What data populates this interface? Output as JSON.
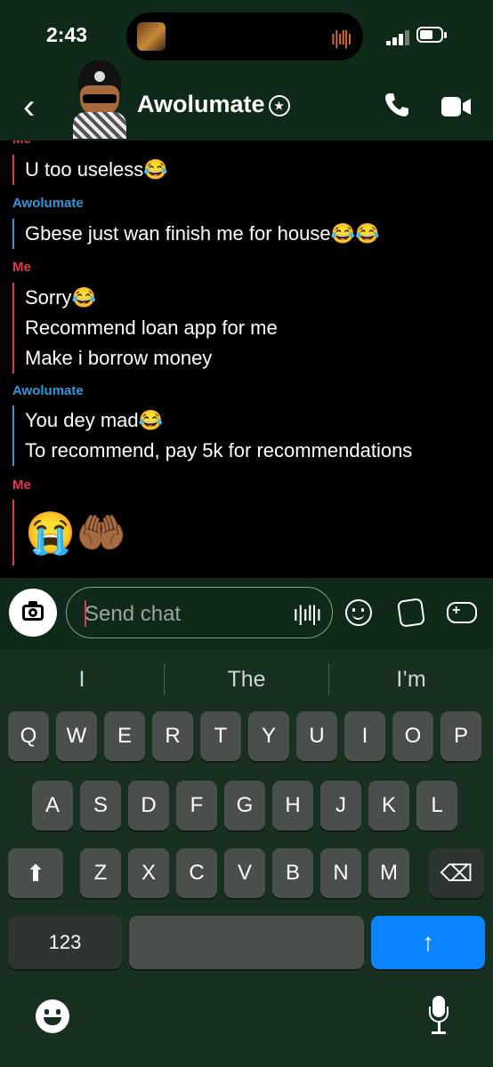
{
  "status": {
    "time": "2:43"
  },
  "header": {
    "contact_name": "Awolumate",
    "badge": "★"
  },
  "messages": [
    {
      "sender_label": "Me",
      "lines": [
        "U too useless😂"
      ]
    },
    {
      "sender_label": "Awolumate",
      "lines": [
        "Gbese just wan finish me for house😂😂"
      ]
    },
    {
      "sender_label": "Me",
      "lines": [
        "Sorry😂",
        "Recommend loan app for me",
        "Make i borrow money"
      ]
    },
    {
      "sender_label": "Awolumate",
      "lines": [
        "You dey mad😂",
        "To recommend, pay 5k for recommendations"
      ]
    },
    {
      "sender_label": "Me",
      "lines": [
        "😭🤲🏾"
      ]
    }
  ],
  "composer": {
    "placeholder": "Send chat"
  },
  "keyboard": {
    "suggestions": [
      "I",
      "The",
      "I’m"
    ],
    "row1": [
      "Q",
      "W",
      "E",
      "R",
      "T",
      "Y",
      "U",
      "I",
      "O",
      "P"
    ],
    "row2": [
      "A",
      "S",
      "D",
      "F",
      "G",
      "H",
      "J",
      "K",
      "L"
    ],
    "row3": [
      "Z",
      "X",
      "C",
      "V",
      "B",
      "N",
      "M"
    ],
    "numbers_key": "123",
    "shift_symbol": "⬆",
    "delete_symbol": "⌫",
    "send_symbol": "↑"
  },
  "colors": {
    "me": "#e5384f",
    "them": "#2f97dc",
    "accent": "#0a84ff"
  }
}
